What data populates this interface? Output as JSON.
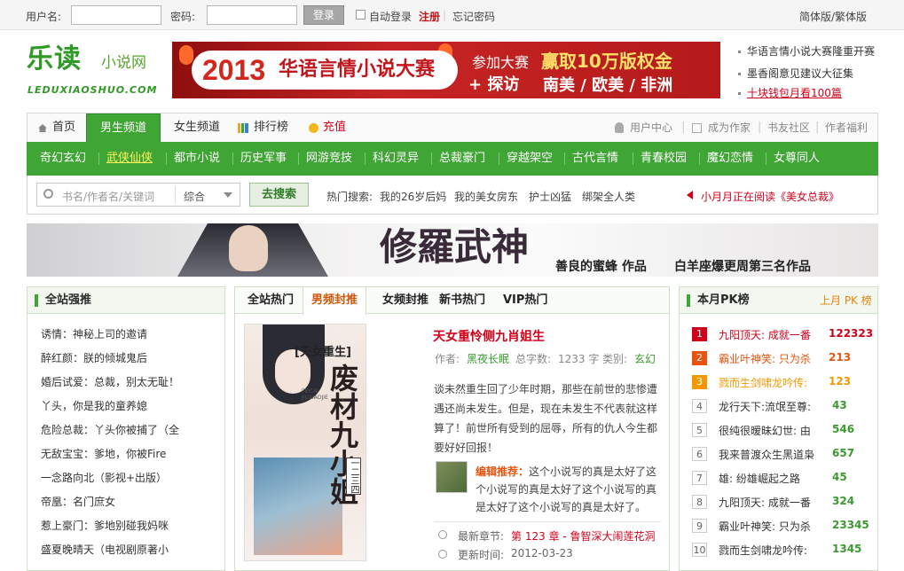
{
  "topbar": {
    "username_label": "用户名:",
    "password_label": "密码:",
    "login_button": "登录",
    "auto_login": "自动登录",
    "register": "注册",
    "forgot": "忘记密码",
    "lang_switch": "简体版/繁体版"
  },
  "logo": {
    "cn": "乐读",
    "sub": "小说网",
    "en": "LEDUXIAOSHUO.COM"
  },
  "banner": {
    "year": "2013",
    "title": "华语言情小说大赛",
    "line1": "参加大赛",
    "prize": "赢取10万版权金",
    "line2": "+ 探访",
    "places": "南美 / 欧美 / 非洲"
  },
  "news": [
    "华语言情小说大赛隆重开赛",
    "墨香阁意见建议大征集",
    "十块钱包月看100篇"
  ],
  "nav1": {
    "home": "首页",
    "male": "男生频道",
    "female": "女生频道",
    "ranking": "排行榜",
    "recharge": "充值",
    "user_center": "用户中心",
    "become_author": "成为作家",
    "community": "书友社区",
    "author_welfare": "作者福利"
  },
  "nav2": [
    "奇幻玄幻",
    "武侠仙侠",
    "都市小说",
    "历史军事",
    "网游竞技",
    "科幻灵异",
    "总裁豪门",
    "穿越架空",
    "古代言情",
    "青春校园",
    "魔幻恋情",
    "女尊同人"
  ],
  "search": {
    "placeholder": "书名/作者名/关键词",
    "select": "综合",
    "button": "去搜索",
    "hot_label": "热门搜索:",
    "hot": [
      "我的26岁后妈",
      "我的美女房东",
      "护士凶猛",
      "绑架全人类"
    ],
    "reading": "小月月正在阅读《美女总裁》"
  },
  "promo": {
    "title": "修羅武神",
    "author": "善良的蜜蜂 作品",
    "slogan": "白羊座爆更周第三名作品"
  },
  "left": {
    "title": "全站强推",
    "items": [
      "诱情：神秘上司的邀请",
      "醉红颜：朕的倾城鬼后",
      "婚后试爱：总裁，别太无耻！",
      "丫头，你是我的童养媳",
      "危险总裁：丫头你被捕了（全",
      "无敌宝宝：爹地，你被Fire",
      "一念路向北（影视+出版）",
      "帝凰：名门庶女",
      "惹上豪门：爹地别碰我妈咪",
      "盛夏晚晴天（电视剧原著小"
    ]
  },
  "center": {
    "tabs": [
      "全站热门",
      "男频封推",
      "女频封推",
      "新书热门",
      "VIP热门"
    ],
    "cover": {
      "tag": "[天女重生]",
      "title": "废材九小姐",
      "pinyin": "FEICAI JIUXIAOJIE",
      "num": "一二三四"
    },
    "book_title": "天女重怜侧九肖姐生",
    "author_label": "作者:",
    "author": "黑夜长眠",
    "words_label": "总字数:",
    "words": "1233 字",
    "cat_label": "类别:",
    "category": "玄幻",
    "desc": "谈未然重生回了少年时期，那些在前世的悲惨遭遇还尚未发生。但是，现在未发生不代表就这样算了！前世所有受到的屈辱，所有的仇人今生都要好好回报！",
    "editor_label": "编辑推荐：",
    "editor_text": "这个小说写的真是太好了这个小说写的真是太好了这个小说写的真是太好了这个小说写的真是太好了。",
    "latest_label": "最新章节:",
    "latest": "第 123 章 - 鲁智深大闹莲花洞",
    "updated_label": "更新时间:",
    "updated": "2012-03-23"
  },
  "right": {
    "title": "本月PK榜",
    "more": "上月 PK 榜",
    "items": [
      {
        "n": "1",
        "t": "九阳顶天: 成就一番",
        "v": "122323"
      },
      {
        "n": "2",
        "t": "霸业叶神笑: 只为杀",
        "v": "213"
      },
      {
        "n": "3",
        "t": "戮而生剑啸龙吟传:",
        "v": "123"
      },
      {
        "n": "4",
        "t": "龙行天下:流氓至尊:",
        "v": "43"
      },
      {
        "n": "5",
        "t": "很纯很暧昧幻世: 由",
        "v": "546"
      },
      {
        "n": "6",
        "t": "我来普渡众生黑道枭",
        "v": "657"
      },
      {
        "n": "7",
        "t": "雄: 纷雄崛起之路",
        "v": "45"
      },
      {
        "n": "8",
        "t": "九阳顶天: 成就一番",
        "v": "324"
      },
      {
        "n": "9",
        "t": "霸业叶神笑: 只为杀",
        "v": "23345"
      },
      {
        "n": "10",
        "t": "戮而生剑啸龙吟传:",
        "v": "1345"
      }
    ]
  },
  "colors": {
    "green": "#3fa534",
    "red": "#d0021b",
    "rank1": "#d0021b",
    "rank2": "#e8530e",
    "rank3": "#f39800"
  }
}
